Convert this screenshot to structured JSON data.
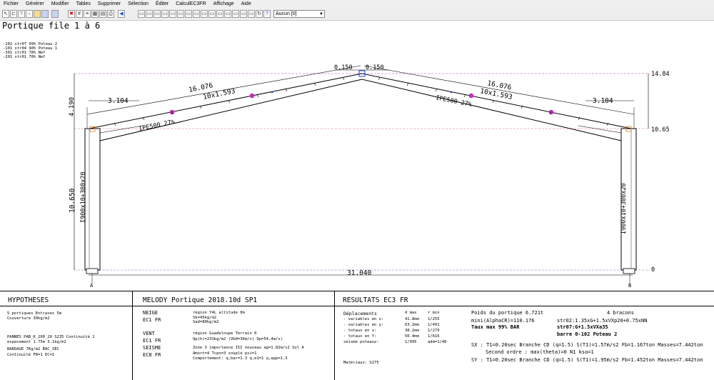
{
  "menu": [
    "Fichier",
    "Générer",
    "Modifier",
    "Tables",
    "Supprimer",
    "Sélection",
    "Éditer",
    "CalculEC3FR",
    "Affichage",
    "Aide"
  ],
  "toolbar": {
    "combo_value": "Aucun [0]"
  },
  "drawing": {
    "title": "Portique file 1 à 6",
    "legend": [
      "-102 str07 99% Poteau 2",
      "-101 str04 98% Poteau 1",
      "-301 str01 78% Nef",
      "-201 str01 78% Nef"
    ],
    "dims": {
      "left_eave_offset": "3.104",
      "right_eave_offset": "3.104",
      "left_rafter_length": "16.076",
      "right_rafter_length": "16.076",
      "left_plate": "10x1.593",
      "right_plate": "10x1.593",
      "apex_left": "0.150",
      "apex_right": "0.150",
      "left_rise": "4.190",
      "left_column_height": "10.650",
      "span": "31.040",
      "level_top": "14.84",
      "level_eave": "10.65",
      "level_base": "0"
    },
    "sections": {
      "left_rafter": "IPE500 27%",
      "right_rafter": "IPE500 27%",
      "left_column": "I900x10+300x20",
      "right_column": "I900x10+300x20"
    },
    "supports": {
      "left": "A",
      "right": "B"
    }
  },
  "hypotheses": {
    "title": "HYPOTHESES",
    "lines": [
      "5 portiques Entraxes 5m",
      "Couverture 30kg/m2",
      "",
      "PANNES PAB_K_200_20 S235  Continuité 1",
      "    espacement 1.75m 3.1kg/m2",
      "BARDAGE 7Kg/m2 BAC_SEC",
      "    Continuité FR=1 EC=1"
    ]
  },
  "melody": {
    "title": "MELODY Portique 2018.10d SP1",
    "rows": [
      {
        "label": "NEIGE",
        "values": [
          "région Y4L altitude 0m"
        ]
      },
      {
        "label": "EC1 FR",
        "values": [
          "Sk=45kg/m2",
          "Sad=80kg/m2"
        ]
      },
      {
        "label": "VENT",
        "values": [
          "région Guadeloupe  Terrain 0"
        ]
      },
      {
        "label": "EC1 FR",
        "values": [
          "Qp(h)=233kg/m2 (Vb0=36m/s) Qp=54,4m/s)"
        ]
      },
      {
        "label": "SEISME",
        "values": [
          "Zone 3 importance III nouveau ag=1.82m/s2  Sol A"
        ]
      },
      {
        "label": "EC8 FR",
        "values": [
          "Amort=4 Tcpo=3 souple psi=1",
          "Comportement: q,bar=1.3 q,e1=1  q,app=1.3"
        ]
      }
    ]
  },
  "results": {
    "title": "RESULTATS EC3 FR",
    "displacement_header": [
      "Déplacements",
      "d max",
      "r min"
    ],
    "displacements": [
      [
        "- variables en x:",
        "41.8mm",
        "1/255"
      ],
      [
        "- variables en y:",
        "63.2mm",
        "1/491"
      ],
      [
        "- totaux en x:",
        "38.2mm",
        "1/279"
      ],
      [
        "- totaux en Y:",
        "50.4mm",
        "1/616"
      ],
      [
        "séisme poteaux:",
        "1/995",
        "adm=1/40"
      ]
    ],
    "materials": "Matériaux: S275",
    "weight": "Poids du portique 6.721t",
    "alpha": "mini(AlphaCR)=110.176",
    "rate": "Taux max 99% BAR",
    "bracing": "4 bracons",
    "combo1": "str02:1.35xG+1.5xVXp20+0.75xNN",
    "combo2": "str07:G+1.5xVXa35",
    "bar": "barre 0-102  Poteau 2",
    "sx": "SX : T1=0.20sec Branche CD (q=1.5) S(T1)=1.57m/s2 Fb=1.167ton Masses=7.442ton",
    "sx2": "Second ordre : max(theta)=0 N1 kso=1",
    "sy": "SY : T1=0.20sec Branche CD (q=1.5) S(T1)=1.95m/s2 Fb=1.452ton Masses=7.442ton"
  }
}
